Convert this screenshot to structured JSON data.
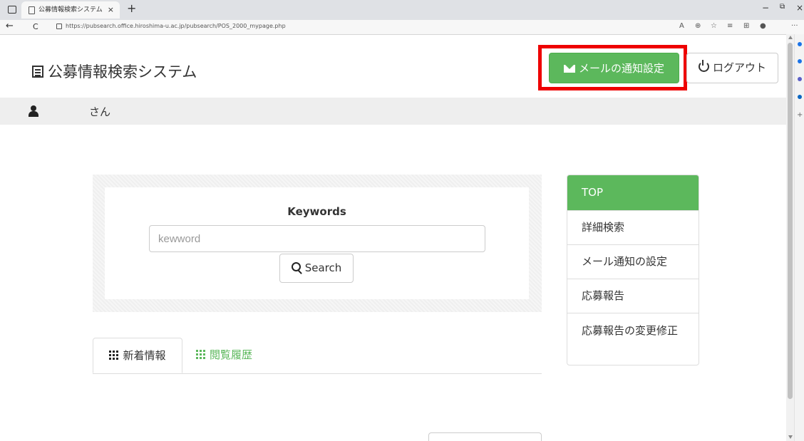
{
  "browser": {
    "tab_title": "公募情報検索システム",
    "tab_close": "×",
    "new_tab": "+",
    "url": "https://pubsearch.office.hiroshima-u.ac.jp/pubsearch/POS_2000_mypage.php",
    "minimize": "−",
    "restore": "⧉",
    "close": "×",
    "back": "←",
    "refresh": "C",
    "more": "···"
  },
  "header": {
    "site_title": "公募情報検索システム",
    "mail_button_label": "メールの通知設定",
    "logout_button_label": "ログアウト"
  },
  "user": {
    "suffix": "さん"
  },
  "search": {
    "label": "Keywords",
    "placeholder": "kewword",
    "value": "",
    "button_label": "Search"
  },
  "tabs": [
    {
      "label": "新着情報",
      "active": true
    },
    {
      "label": "閲覧履歴",
      "active": false
    }
  ],
  "side_menu": [
    {
      "label": "TOP",
      "active": true
    },
    {
      "label": "詳細検索",
      "active": false
    },
    {
      "label": "メール通知の設定",
      "active": false
    },
    {
      "label": "応募報告",
      "active": false
    },
    {
      "label": "応募報告の変更修正",
      "active": false
    }
  ],
  "colors": {
    "accent_green": "#5cb85c",
    "highlight_red": "#ee0000"
  }
}
